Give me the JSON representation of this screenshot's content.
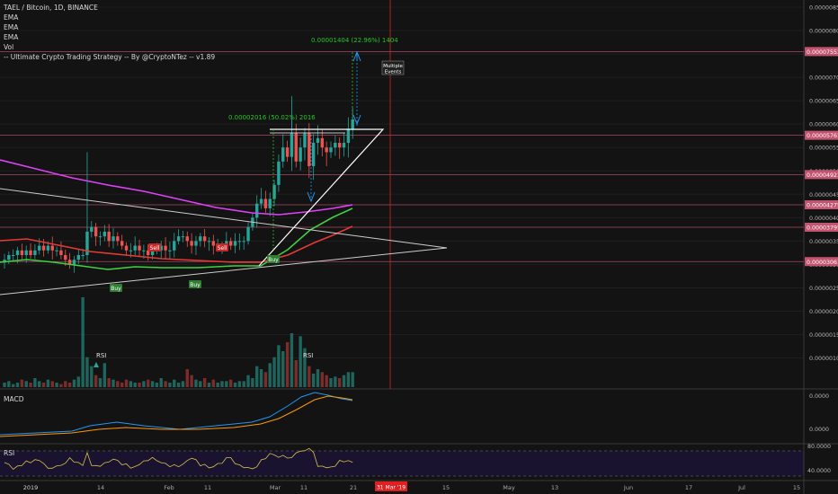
{
  "header": {
    "symbol_line": "TAEL / Bitcoin, 1D, BINANCE",
    "indicators": [
      "EMA",
      "EMA",
      "EMA",
      "Vol"
    ],
    "strategy": "-- Ultimate Crypto Trading Strategy -- By @CryptoNTez -- v1.89"
  },
  "colors": {
    "background": "#131313",
    "up_candle": "#26a69a",
    "down_candle": "#ef5350",
    "ema_magenta": "#e040fb",
    "ema_red": "#e53935",
    "ema_green": "#3fd13f",
    "measure_green": "#26c426",
    "date_marker": "#e02020",
    "level_line": "#c2546f",
    "rsi_band": "#1a1330",
    "macd_line": "#2196f3",
    "signal_line": "#ff9800",
    "rsi_line": "#d4c24a"
  },
  "chart_data": [
    {
      "type": "candlestick",
      "title": "TAEL / Bitcoin, 1D, BINANCE",
      "ylim": [
        3e-07,
        8.5e-06
      ],
      "y_ticks": [
        "0.00000850",
        "0.00000800",
        "0.00000750",
        "0.00000700",
        "0.00000650",
        "0.00000600",
        "0.00000550",
        "0.00000500",
        "0.00000450",
        "0.00000400",
        "0.00000350",
        "0.00000300",
        "0.00000250",
        "0.00000200",
        "0.00000150",
        "0.00000100"
      ],
      "x_ticks": [
        "2019",
        "14",
        "Feb",
        "11",
        "Mar",
        "11",
        "21",
        "15",
        "May",
        "13",
        "Jun",
        "17",
        "Jul",
        "15"
      ],
      "highlight_date": "31 Mar '19",
      "price_levels": [
        {
          "value": 7.552e-06,
          "label": "0.00007552"
        },
        {
          "value": 5.761e-06,
          "label": "0.00005761"
        },
        {
          "value": 4.921e-06,
          "label": "0.00004921"
        },
        {
          "value": 4.275e-06,
          "label": "0.00004275"
        },
        {
          "value": 3.795e-06,
          "label": "0.00003795"
        },
        {
          "value": 3.061e-06,
          "label": "0.00003061"
        }
      ],
      "close_values": [
        3.1e-06,
        3.2e-06,
        3.2e-06,
        3.3e-06,
        3.2e-06,
        3.3e-06,
        3.2e-06,
        3.3e-06,
        3.4e-06,
        3.3e-06,
        3.4e-06,
        3.3e-06,
        3.3e-06,
        3.2e-06,
        3.1e-06,
        3e-06,
        3.1e-06,
        3.2e-06,
        3.2e-06,
        3.7e-06,
        3.8e-06,
        3.6e-06,
        3.6e-06,
        3.7e-06,
        3.5e-06,
        3.6e-06,
        3.5e-06,
        3.4e-06,
        3.3e-06,
        3.3e-06,
        3.4e-06,
        3.3e-06,
        3.3e-06,
        3.2e-06,
        3.3e-06,
        3.3e-06,
        3.4e-06,
        3.3e-06,
        3.3e-06,
        3.5e-06,
        3.6e-06,
        3.6e-06,
        3.5e-06,
        3.4e-06,
        3.5e-06,
        3.6e-06,
        3.5e-06,
        3.5e-06,
        3.4e-06,
        3.4e-06,
        3.4e-06,
        3.5e-06,
        3.4e-06,
        3.5e-06,
        3.5e-06,
        3.5e-06,
        3.8e-06,
        4e-06,
        4.3e-06,
        4.4e-06,
        4.2e-06,
        4.4e-06,
        4.7e-06,
        5.2e-06,
        5.5e-06,
        5.3e-06,
        5.8e-06,
        5.2e-06,
        5.5e-06,
        5.8e-06,
        5.1e-06,
        5.6e-06,
        5.7e-06,
        5.5e-06,
        5.4e-06,
        5.5e-06,
        5.6e-06,
        5.5e-06,
        5.6e-06,
        5.9e-06,
        6.1e-06
      ],
      "annotations": [
        {
          "text": "0.00001404 (22.96%) 1404"
        },
        {
          "text": "0.00002016 (50.02%) 2016"
        },
        {
          "text": "Multiple Events"
        },
        {
          "text": "Sell"
        },
        {
          "text": "Sell"
        },
        {
          "text": "Buy"
        },
        {
          "text": "Buy"
        },
        {
          "text": "Buy"
        }
      ]
    },
    {
      "type": "bar",
      "title": "Vol",
      "values": [
        3,
        4,
        2,
        3,
        5,
        4,
        3,
        6,
        4,
        3,
        5,
        4,
        3,
        2,
        4,
        3,
        5,
        7,
        60,
        20,
        14,
        8,
        6,
        16,
        6,
        5,
        4,
        3,
        5,
        4,
        3,
        3,
        4,
        5,
        4,
        3,
        6,
        4,
        3,
        5,
        3,
        4,
        12,
        8,
        5,
        4,
        6,
        3,
        5,
        3,
        4,
        4,
        5,
        3,
        4,
        4,
        8,
        6,
        14,
        12,
        10,
        16,
        20,
        28,
        24,
        30,
        36,
        18,
        34,
        26,
        14,
        9,
        12,
        10,
        8,
        6,
        7,
        6,
        8,
        10,
        10
      ],
      "labels": [
        "RSI",
        "RSI"
      ]
    },
    {
      "type": "line",
      "title": "MACD",
      "y_ticks": [
        "0.0000",
        "0.0000"
      ],
      "series": [
        {
          "values": []
        },
        {
          "values": []
        }
      ]
    },
    {
      "type": "line",
      "title": "RSI",
      "y_ticks": [
        "80.0000",
        "40.0000"
      ],
      "series": [
        {
          "values": []
        }
      ]
    }
  ]
}
